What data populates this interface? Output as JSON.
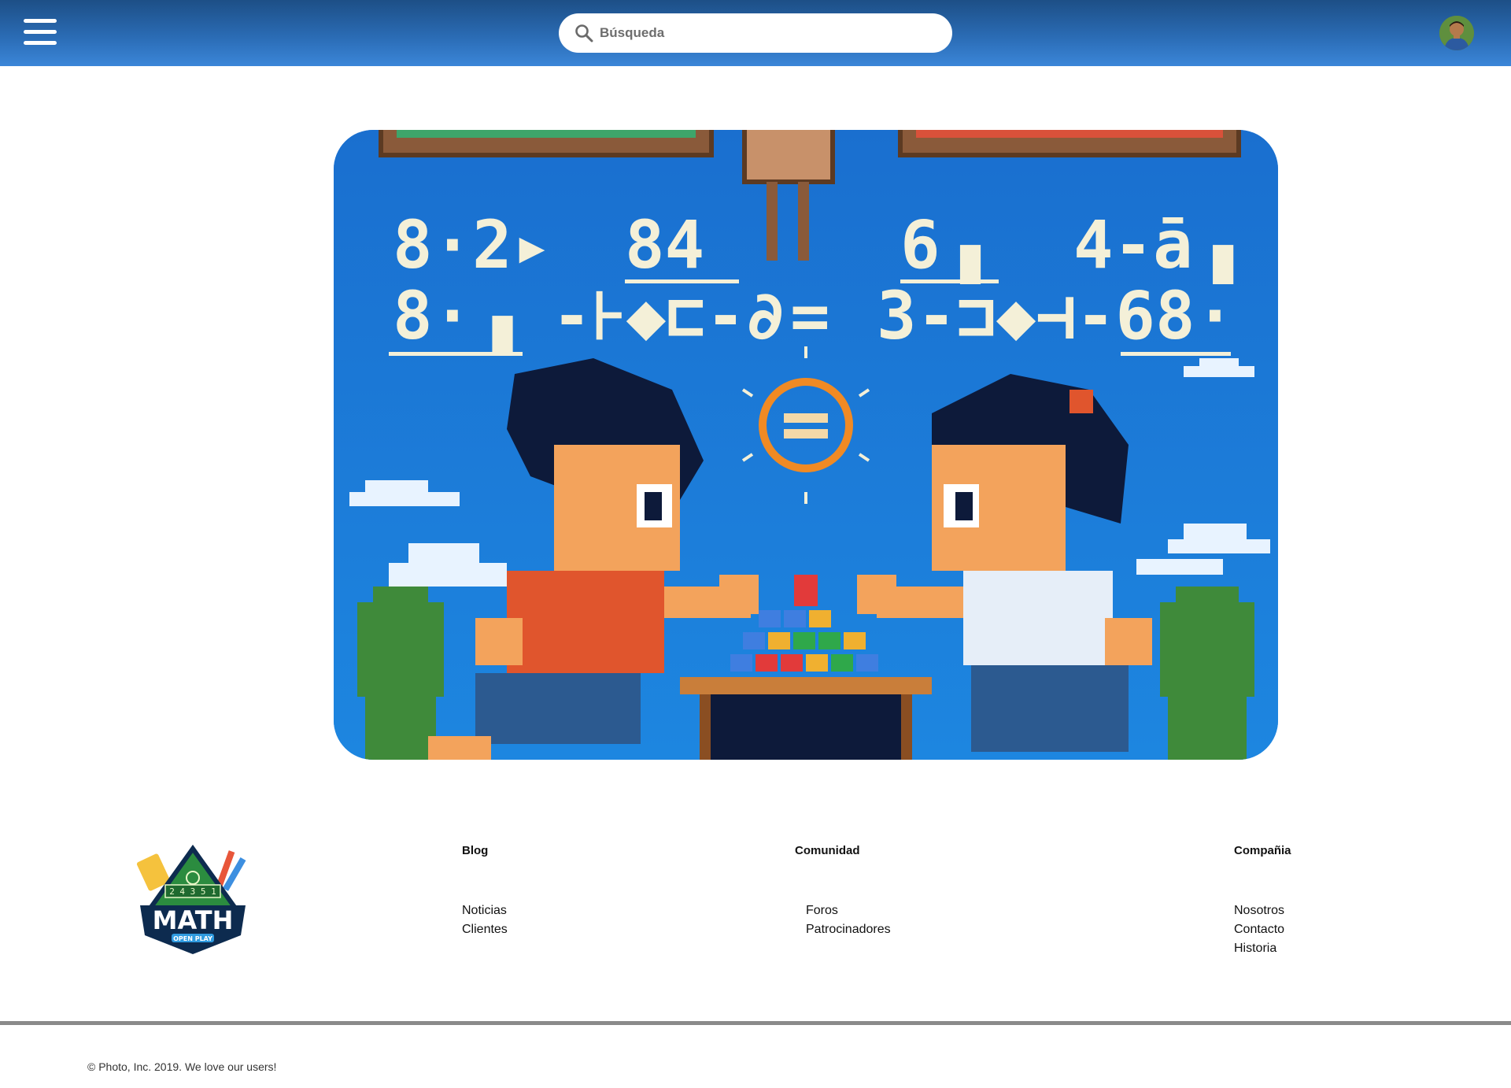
{
  "header": {
    "search_placeholder": "Búsqueda"
  },
  "hero": {
    "image": "pixel-art-math-duel-illustration"
  },
  "footer": {
    "logo": {
      "title": "MATH",
      "subtitle": "OPEN PLAY",
      "numbers": "2 4 3 5 1"
    },
    "columns": {
      "blog": {
        "title": "Blog",
        "links": [
          "Noticias",
          "Clientes"
        ]
      },
      "community": {
        "title": "Comunidad",
        "links": [
          "Foros",
          "Patrocinadores"
        ]
      },
      "company": {
        "title": "Compañia",
        "links": [
          "Nosotros",
          "Contacto",
          "Historia"
        ]
      }
    },
    "copyright": "© Photo, Inc. 2019. We love our users!"
  }
}
